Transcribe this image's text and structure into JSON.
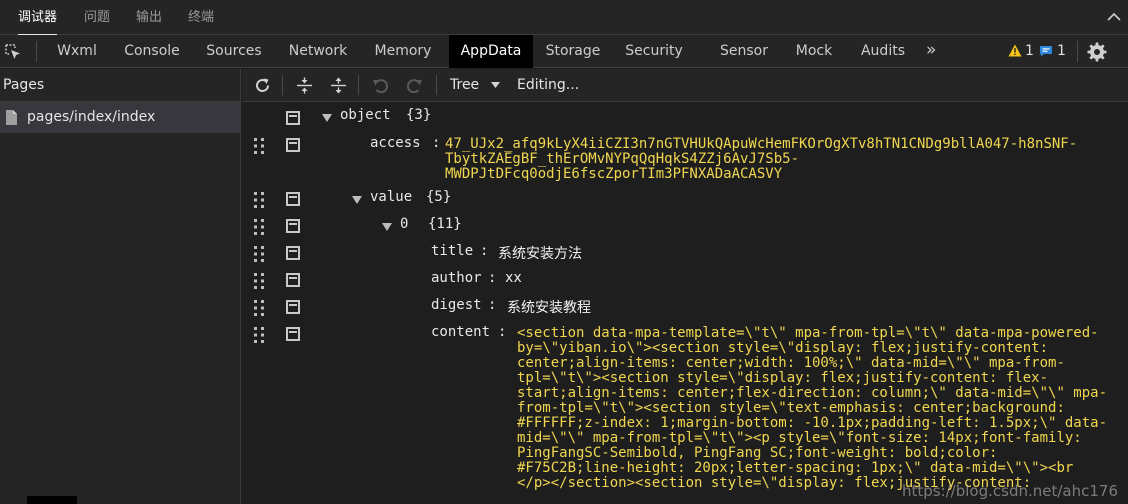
{
  "panel_tabs": [
    "调试器",
    "问题",
    "输出",
    "终端"
  ],
  "devtools_tabs": [
    "Wxml",
    "Console",
    "Sources",
    "Network",
    "Memory",
    "AppData",
    "Storage",
    "Security",
    "Sensor",
    "Mock",
    "Audits"
  ],
  "more_tabs": "»",
  "warning_count": "1",
  "message_count": "1",
  "colors": {
    "warning": "#f5c518",
    "message": "#2e86de",
    "accent_value": "#f0d74f"
  },
  "sidebar": {
    "header": "Pages",
    "items": [
      {
        "label": "pages/index/index",
        "icon": "file-icon"
      }
    ]
  },
  "main_toolbar": {
    "view_mode": "Tree",
    "status": "Editing..."
  },
  "tree": {
    "root_key": "object",
    "root_count": "{3}",
    "access_key": "access",
    "access_colon": ":",
    "access_lines": [
      "47_UJx2_afq9kLyX4iiCZI3n7nGTVHUkQApuWcHemFKOrOgXTv8hTN1CNDg9bllA047-h8nSNF-",
      "TbytkZAEgBF_thErOMvNYPqQqHqkS4ZZj6AvJ7Sb5-",
      "MWDPJtDFcq0odjE6fscZporTIm3PFNXADaACASVY"
    ],
    "value_key": "value",
    "value_count": "{5}",
    "item_index": "0",
    "item_count": "{11}",
    "fields": [
      {
        "key": "title",
        "colon": ":",
        "value": "系统安装方法"
      },
      {
        "key": "author",
        "colon": ":",
        "value": "xx"
      },
      {
        "key": "digest",
        "colon": ":",
        "value": "系统安装教程"
      }
    ],
    "content_key": "content",
    "content_colon": ":",
    "content_lines": [
      "<section data-mpa-template=\\\"t\\\" mpa-from-tpl=\\\"t\\\" data-mpa-powered-",
      "by=\\\"yiban.io\\\"><section style=\\\"display: flex;justify-content:",
      "center;align-items: center;width: 100%;\\\" data-mid=\\\"\\\" mpa-from-",
      "tpl=\\\"t\\\"><section style=\\\"display: flex;justify-content: flex-",
      "start;align-items: center;flex-direction: column;\\\" data-mid=\\\"\\\" mpa-",
      "from-tpl=\\\"t\\\"><section style=\\\"text-emphasis: center;background:",
      "#FFFFFF;z-index: 1;margin-bottom: -10.1px;padding-left: 1.5px;\\\" data-",
      "mid=\\\"\\\" mpa-from-tpl=\\\"t\\\"><p style=\\\"font-size: 14px;font-family:",
      "PingFangSC-Semibold, PingFang SC;font-weight: bold;color:",
      "#F75C2B;line-height: 20px;letter-spacing: 1px;\\\" data-mid=\\\"\\\"><br",
      "</p></section><section style=\\\"display: flex;justify-content:"
    ]
  },
  "watermark": "https://blog.csdn.net/ahc176"
}
